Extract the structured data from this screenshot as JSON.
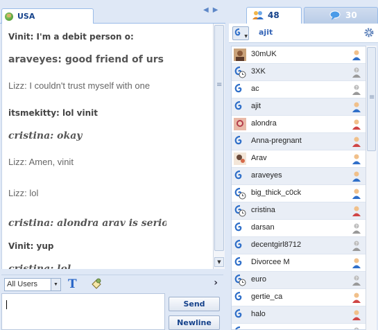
{
  "chat": {
    "room_tab": "USA",
    "messages": [
      {
        "text": "Vinit: I'm a debit person o:",
        "style": "bold"
      },
      {
        "text": "araveyes: good friend of urs",
        "style": "big"
      },
      {
        "text": "Lizz: I couldn't trust myself with one",
        "style": "plain"
      },
      {
        "text": "itsmekitty: lol vinit",
        "style": "bold"
      },
      {
        "text": "cristina: okay",
        "style": "italic"
      },
      {
        "text": "Lizz: Amen, vinit",
        "style": "plain"
      },
      {
        "text": "Lizz: lol",
        "style": "plain"
      },
      {
        "text": "cristina: alondra arav is serious",
        "style": "italic"
      },
      {
        "text": "Vinit: yup",
        "style": "bold"
      },
      {
        "text": "cristina: lol",
        "style": "italic"
      }
    ]
  },
  "toolbar": {
    "recipient_select": "All Users",
    "send_label": "Send",
    "newline_label": "Newline"
  },
  "panel": {
    "users_count": "48",
    "rooms_count": "30",
    "my_name": "ajit",
    "users": [
      {
        "name": "30mUK",
        "avatar": "photo",
        "gender": "male"
      },
      {
        "name": "3XK",
        "avatar": "away",
        "gender": "unknown"
      },
      {
        "name": "ac",
        "avatar": "default",
        "gender": "unknown"
      },
      {
        "name": "ajit",
        "avatar": "default",
        "gender": "male"
      },
      {
        "name": "alondra",
        "avatar": "photo-female",
        "gender": "female"
      },
      {
        "name": "Anna-pregnant",
        "avatar": "default",
        "gender": "female"
      },
      {
        "name": "Arav",
        "avatar": "photo-arav",
        "gender": "male"
      },
      {
        "name": "araveyes",
        "avatar": "default",
        "gender": "male"
      },
      {
        "name": "big_thick_c0ck",
        "avatar": "away",
        "gender": "male"
      },
      {
        "name": "cristina",
        "avatar": "away",
        "gender": "female"
      },
      {
        "name": "darsan",
        "avatar": "default",
        "gender": "unknown"
      },
      {
        "name": "decentgirl8712",
        "avatar": "default",
        "gender": "unknown"
      },
      {
        "name": "Divorcee M",
        "avatar": "default",
        "gender": "male"
      },
      {
        "name": "euro",
        "avatar": "away",
        "gender": "unknown"
      },
      {
        "name": "gertie_ca",
        "avatar": "default",
        "gender": "female"
      },
      {
        "name": "halo",
        "avatar": "default",
        "gender": "female"
      },
      {
        "name": "",
        "avatar": "default",
        "gender": "unknown"
      }
    ]
  },
  "colors": {
    "male": "#2f6fc9",
    "female": "#d04545",
    "unknown": "#8a8a8a",
    "accent": "#15428b"
  },
  "icons": {
    "room_flag": "globe-icon",
    "users_tab": "users-group-icon",
    "rooms_tab": "speech-bubble-icon",
    "text_format": "text-format-icon",
    "emoticon": "emoticon-icon",
    "settings": "gear-icon"
  }
}
